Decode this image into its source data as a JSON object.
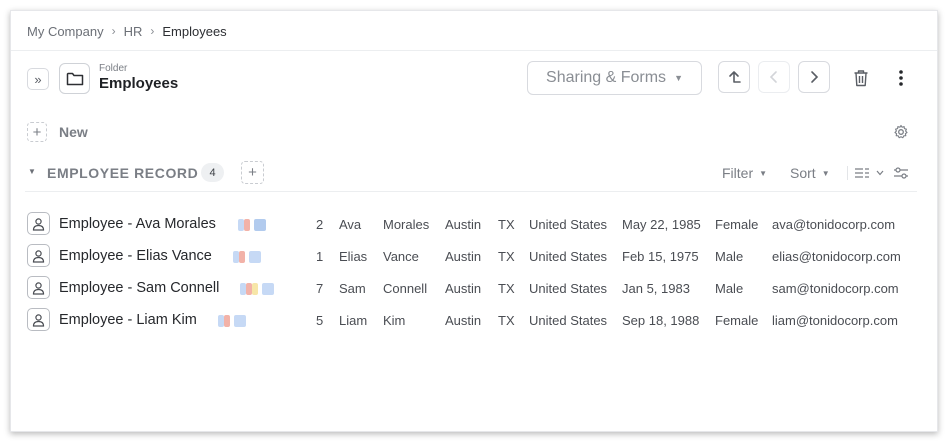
{
  "breadcrumb": {
    "items": [
      "My Company",
      "HR"
    ],
    "current": "Employees"
  },
  "folder": {
    "caption": "Folder",
    "title": "Employees"
  },
  "toolbar": {
    "sharing_label": "Sharing & Forms"
  },
  "new_label": "New",
  "section": {
    "title": "EMPLOYEE RECORD",
    "count": "4",
    "filter_label": "Filter",
    "sort_label": "Sort"
  },
  "colors": {
    "chip_blue": "#c6d9f5",
    "chip_red": "#f2b2a8",
    "chip_yellow": "#f7e6a8",
    "chip_blue_dark": "#b2cbee"
  },
  "rows": [
    {
      "name": "Employee - Ava Morales",
      "num": "2",
      "first": "Ava",
      "last": "Morales",
      "city": "Austin",
      "state": "TX",
      "country": "United States",
      "dob": "May 22, 1985",
      "gender": "Female",
      "email": "ava@tonidocorp.com"
    },
    {
      "name": "Employee - Elias Vance",
      "num": "1",
      "first": "Elias",
      "last": "Vance",
      "city": "Austin",
      "state": "TX",
      "country": "United States",
      "dob": "Feb 15, 1975",
      "gender": "Male",
      "email": "elias@tonidocorp.com"
    },
    {
      "name": "Employee - Sam Connell",
      "num": "7",
      "first": "Sam",
      "last": "Connell",
      "city": "Austin",
      "state": "TX",
      "country": "United States",
      "dob": "Jan 5, 1983",
      "gender": "Male",
      "email": "sam@tonidocorp.com"
    },
    {
      "name": "Employee - Liam Kim",
      "num": "5",
      "first": "Liam",
      "last": "Kim",
      "city": "Austin",
      "state": "TX",
      "country": "United States",
      "dob": "Sep 18, 1988",
      "gender": "Female",
      "email": "liam@tonidocorp.com"
    }
  ]
}
